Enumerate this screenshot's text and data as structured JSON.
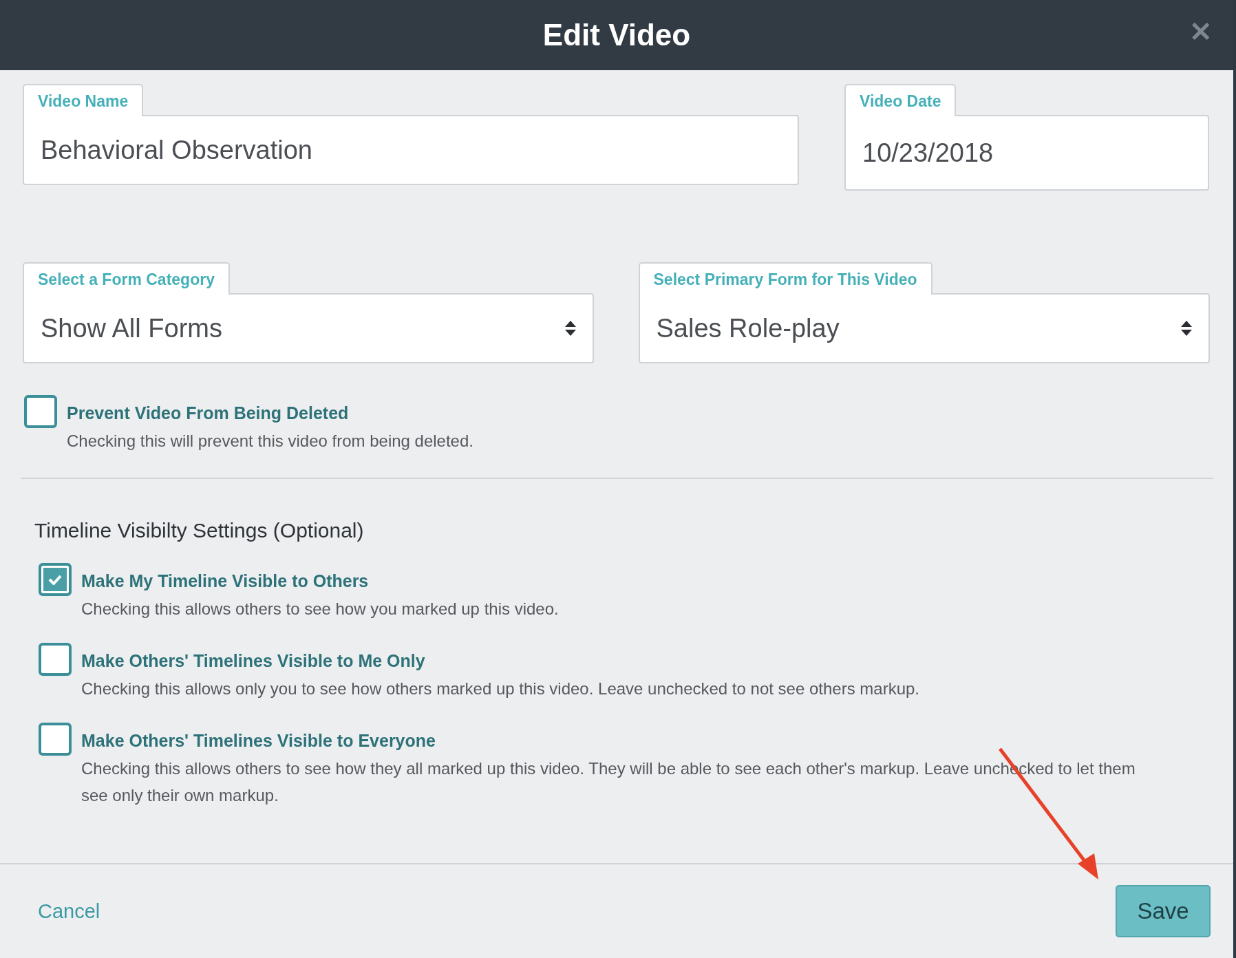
{
  "dialog": {
    "title": "Edit Video",
    "close": "✕"
  },
  "fields": [
    {
      "kind": "text",
      "label": "Video Name",
      "value": "Behavioral Observation"
    },
    {
      "kind": "text",
      "label": "Video Date",
      "value": "10/23/2018"
    }
  ],
  "selects": [
    {
      "label": "Select a Form Category",
      "value": "Show All Forms"
    },
    {
      "label": "Select Primary Form for This Video",
      "value": "Sales Role-play"
    }
  ],
  "protect": {
    "label": "Prevent Video From Being Deleted",
    "description": "Checking this will prevent this video from being deleted.",
    "checked": false
  },
  "visibility": {
    "heading": "Timeline Visibilty Settings (Optional)",
    "options": [
      {
        "label": "Make My Timeline Visible to Others",
        "description": "Checking this allows others to see how you marked up this video.",
        "checked": true
      },
      {
        "label": "Make Others' Timelines Visible to Me Only",
        "description": "Checking this allows only you to see how others marked up this video. Leave unchecked to not see others markup.",
        "checked": false
      },
      {
        "label": "Make Others' Timelines Visible to Everyone",
        "description": "Checking this allows others to see how they all marked up this video. They will be able to see each other's markup. Leave unchecked to let them see only their own markup.",
        "checked": false
      }
    ]
  },
  "footer": {
    "cancel": "Cancel",
    "save": "Save"
  }
}
